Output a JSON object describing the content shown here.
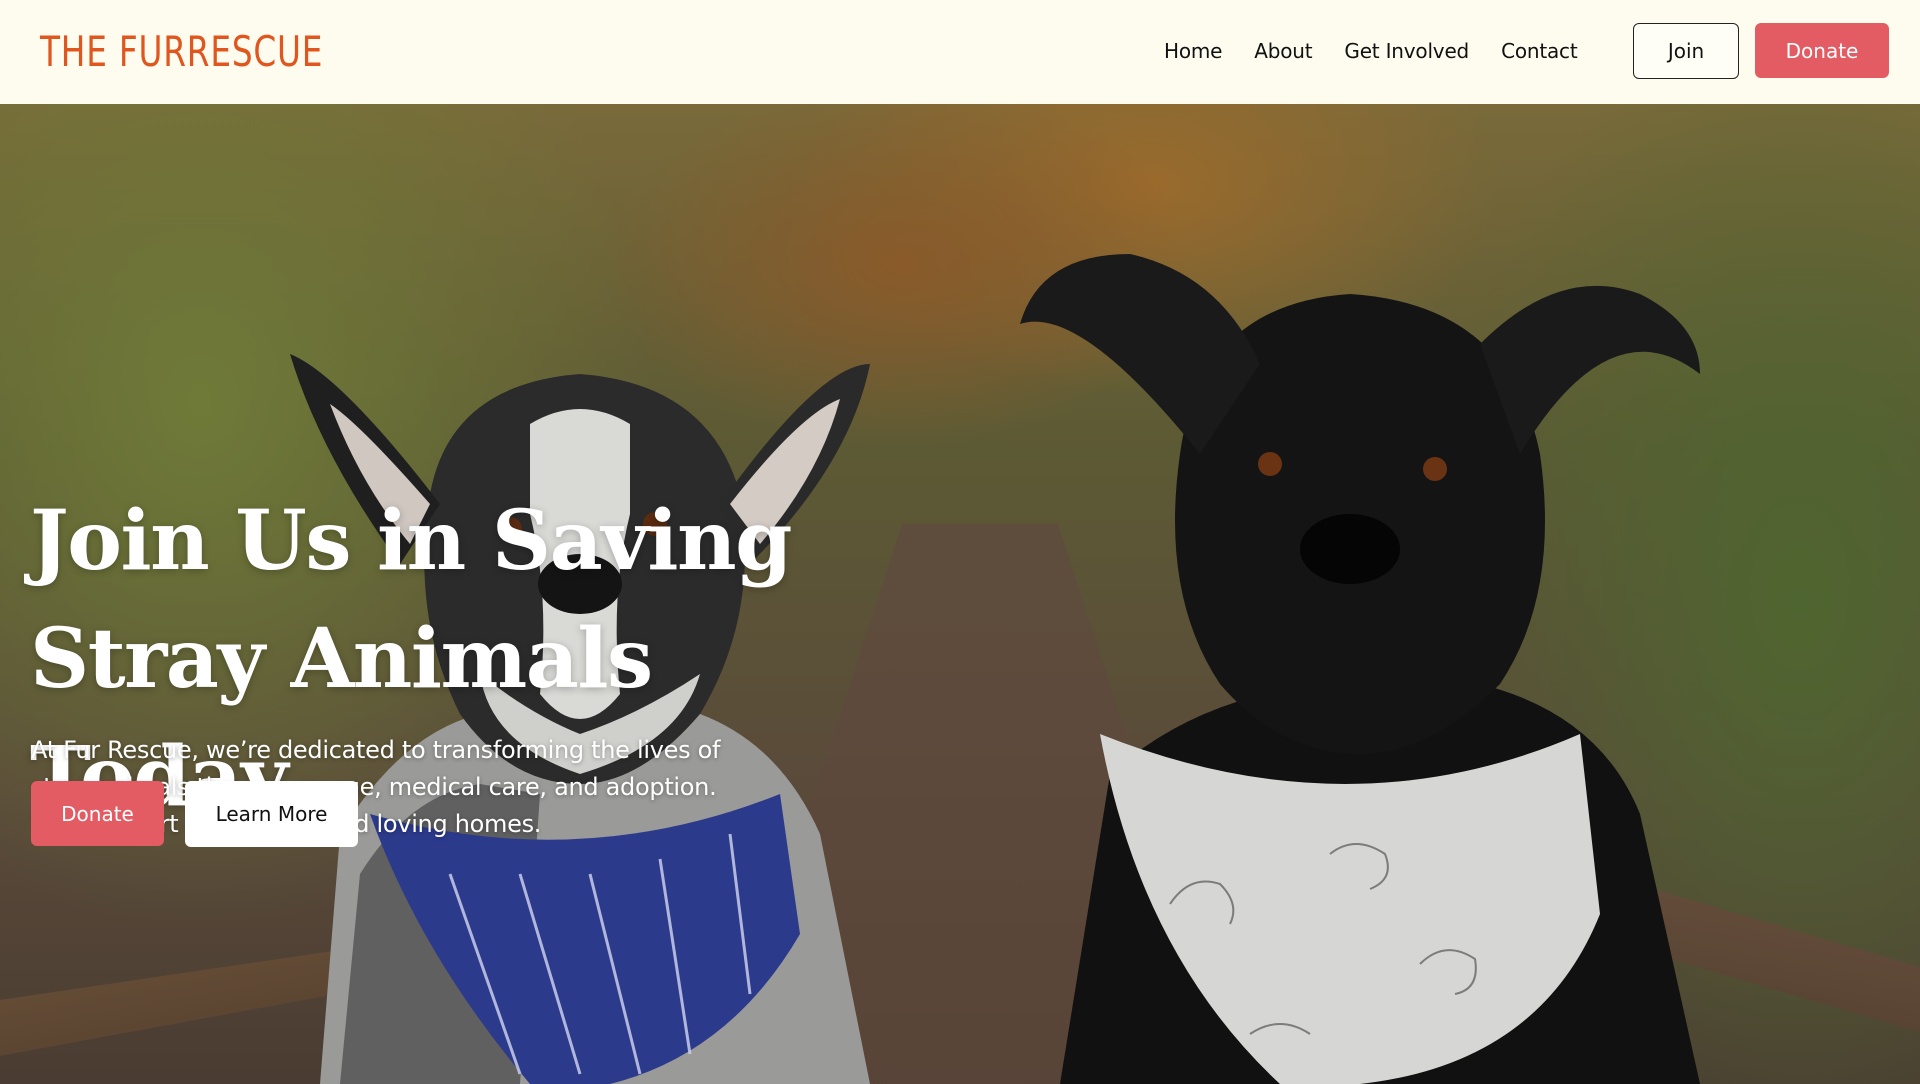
{
  "header": {
    "logo": "THE FURRESCUE",
    "nav": [
      "Home",
      "About",
      "Get Involved",
      "Contact"
    ],
    "join_label": "Join",
    "donate_label": "Donate"
  },
  "hero": {
    "title_line1": "Join Us in Saving",
    "title_line2": "Stray Animals Today",
    "subtitle_line1": "At Fur Rescue, we’re dedicated to transforming the lives of",
    "subtitle_line2": "stray animals through rescue, medical care, and adoption.",
    "subtitle_line3": "Your support helps them find loving homes.",
    "donate_label": "Donate",
    "learn_more_label": "Learn More",
    "image_subject": "two dogs wearing bandanas on a forest trail"
  },
  "colors": {
    "brand_orange": "#e0561f",
    "donate_red": "#e45c63",
    "header_bg": "#fefcef",
    "hero_text": "#ffffff"
  }
}
